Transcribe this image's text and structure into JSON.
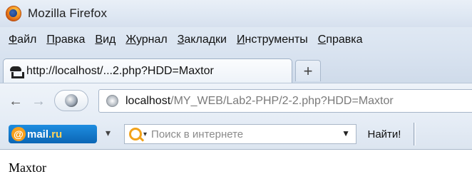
{
  "window": {
    "title": "Mozilla Firefox"
  },
  "menubar": {
    "items": [
      {
        "accel": "Ф",
        "rest": "айл"
      },
      {
        "accel": "П",
        "rest": "равка"
      },
      {
        "accel": "В",
        "rest": "ид"
      },
      {
        "accel": "Ж",
        "rest": "урнал"
      },
      {
        "accel": "З",
        "rest": "акладки"
      },
      {
        "accel": "И",
        "rest": "нструменты"
      },
      {
        "accel": "С",
        "rest": "правка"
      }
    ]
  },
  "tabs": {
    "active_title": "http://localhost/...2.php?HDD=Maxtor",
    "new_tab_label": "+"
  },
  "navbar": {
    "back_glyph": "←",
    "forward_glyph": "→",
    "url_host": "localhost",
    "url_path": "/MY_WEB/Lab2-PHP/2-2.php?HDD=Maxtor"
  },
  "toolbar2": {
    "logo_at": "@",
    "logo_name": "mail",
    "logo_domain": ".ru",
    "dropdown_glyph": "▾",
    "search_placeholder": "Поиск в интернете",
    "search_dropdown_glyph": "▼",
    "find_button": "Найти!"
  },
  "page": {
    "text": "Maxtor"
  },
  "icons": {
    "app": "firefox-logo-icon",
    "tab": "incognito-hat-icon",
    "site": "globe-icon",
    "search_engine": "search-engine-icon"
  }
}
